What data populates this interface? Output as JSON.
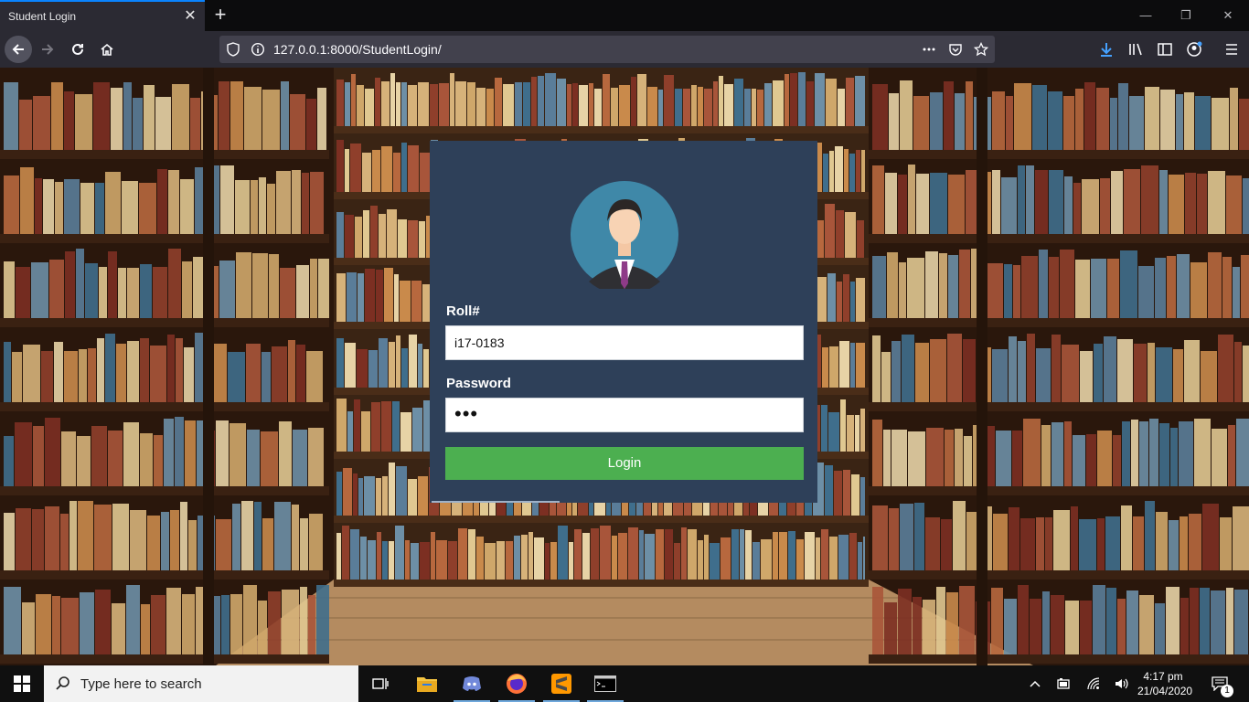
{
  "browser": {
    "tab_title": "Student Login",
    "tab_close_glyph": "✕",
    "new_tab_glyph": "+",
    "url": "127.0.0.1:8000/StudentLogin/",
    "window_controls": [
      "—",
      "❐",
      "✕"
    ]
  },
  "login": {
    "roll_label": "Roll#",
    "roll_value": "i17-0183",
    "password_label": "Password",
    "password_mask": "•••",
    "login_button": "Login"
  },
  "taskbar": {
    "search_placeholder": "Type here to search",
    "time": "4:17 pm",
    "date": "21/04/2020",
    "notification_count": "1"
  },
  "colors": {
    "card_bg": "#2e4059",
    "login_button": "#4caf50",
    "accent": "#0a84ff"
  }
}
